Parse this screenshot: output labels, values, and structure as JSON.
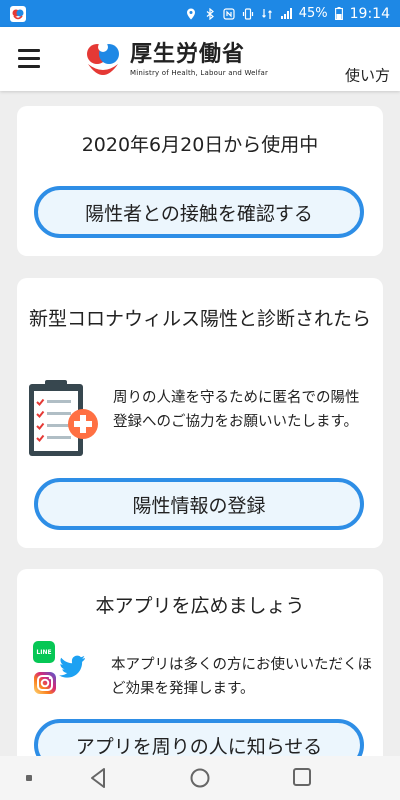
{
  "status_bar": {
    "battery": "45%",
    "time": "19:14"
  },
  "header": {
    "title": "厚生労働省",
    "subtitle": "Ministry of Health, Labour and Welfar",
    "usage_link": "使い方"
  },
  "card_usage": {
    "since_text": "2020年6月20日から使用中",
    "button_label": "陽性者との接触を確認する"
  },
  "card_positive": {
    "heading": "新型コロナウィルス陽性と診断されたら",
    "description": "周りの人達を守るために匿名での陽性登録へのご協力をお願いいたします。",
    "button_label": "陽性情報の登録"
  },
  "card_share": {
    "heading": "本アプリを広めましょう",
    "description": "本アプリは多くの方にお使いいただくほど効果を発揮します。",
    "button_label": "アプリを周りの人に知らせる",
    "line_icon_text": "LINE"
  },
  "colors": {
    "status_bar": "#1e88e5",
    "accent": "#2e8ee6",
    "button_fill": "#ecf6fd",
    "clipboard": "#37474f",
    "plus_badge": "#ff7043",
    "line_green": "#06c755",
    "twitter_blue": "#1da1f2"
  }
}
